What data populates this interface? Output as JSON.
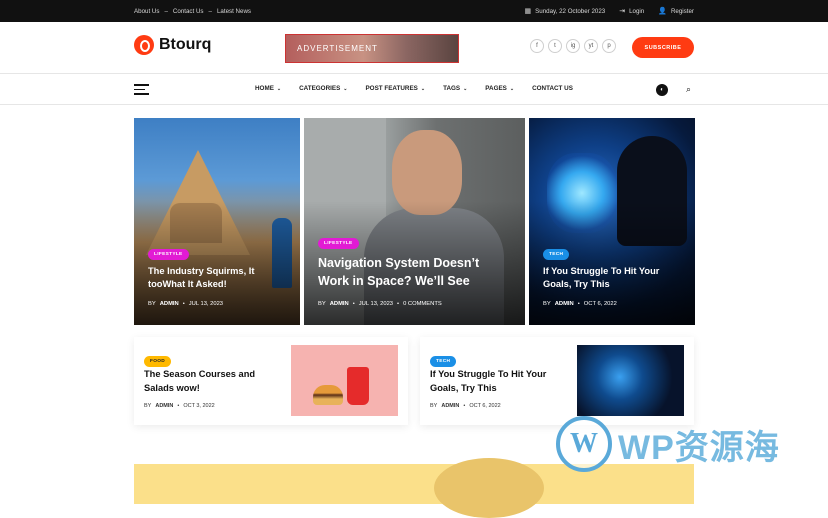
{
  "topbar": {
    "links": [
      "About Us",
      "Contact Us",
      "Latest News"
    ],
    "separator": "–",
    "date": "Sunday, 22 October 2023",
    "login": "Login",
    "register": "Register"
  },
  "header": {
    "logo_text": "Btourq",
    "ad_text": "ADVERTISEMENT",
    "socials": [
      "f",
      "t",
      "ig",
      "yt",
      "p"
    ],
    "subscribe_label": "SUBSCRIBE"
  },
  "nav": {
    "items": [
      {
        "label": "HOME",
        "dropdown": true
      },
      {
        "label": "CATEGORIES",
        "dropdown": true
      },
      {
        "label": "POST FEATURES",
        "dropdown": true
      },
      {
        "label": "TAGS",
        "dropdown": true
      },
      {
        "label": "PAGES",
        "dropdown": true
      },
      {
        "label": "CONTACT US",
        "dropdown": false
      }
    ]
  },
  "hero": [
    {
      "tag": "LIFESTYLE",
      "title": "The Industry Squirms, It tooWhat It Asked!",
      "author": "ADMIN",
      "date": "JUL 13, 2023",
      "by": "BY"
    },
    {
      "tag": "LIFESTYLE",
      "title": "Navigation System Doesn’t Work in Space? We’ll See",
      "author": "ADMIN",
      "date": "JUL 13, 2023",
      "comments": "0 COMMENTS",
      "by": "BY"
    },
    {
      "tag": "TECH",
      "title": "If You Struggle To Hit Your Goals, Try This",
      "author": "ADMIN",
      "date": "OCT 6, 2022",
      "by": "BY"
    }
  ],
  "row2": [
    {
      "tag": "FOOD",
      "title": "The Season Courses and Salads wow!",
      "author": "ADMIN",
      "date": "OCT 3, 2022",
      "by": "BY"
    },
    {
      "tag": "TECH",
      "title": "If You Struggle To Hit Your Goals, Try This",
      "author": "ADMIN",
      "date": "OCT 6, 2022",
      "by": "BY"
    }
  ],
  "watermark": {
    "logo": "W",
    "text": "WP资源海"
  },
  "colors": {
    "brand": "#ff3b12",
    "lifestyle": "#e21bd4",
    "tech": "#1a8fe6",
    "food": "#ffb900"
  }
}
